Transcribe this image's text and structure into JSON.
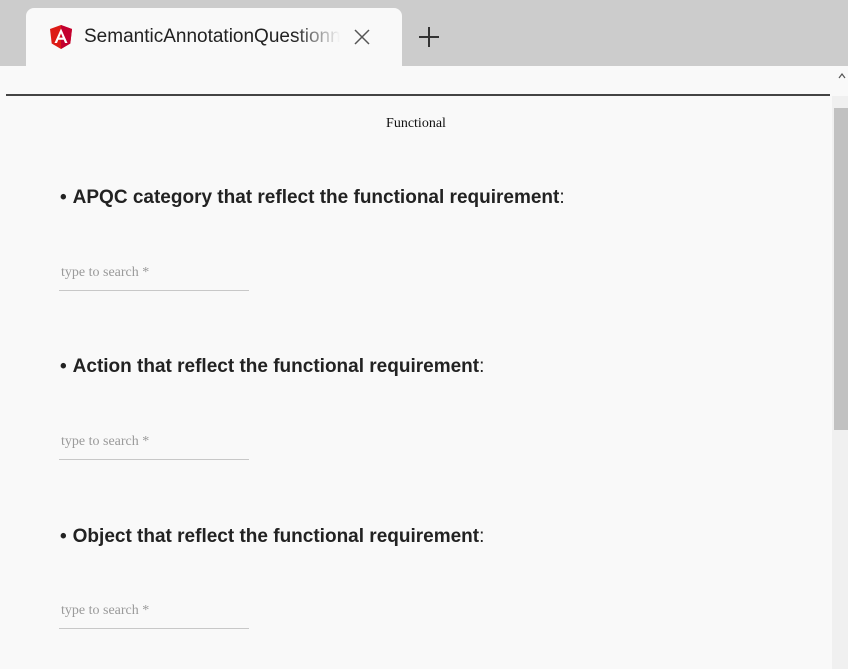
{
  "browser": {
    "tab": {
      "title": "SemanticAnnotationQuestionnaire",
      "icon": "angular-logo-icon"
    },
    "colors": {
      "angular_red": "#dd1b16",
      "tabbar_bg": "#cccccc"
    }
  },
  "page": {
    "section_title": "Functional",
    "questions": [
      {
        "bullet": "•",
        "label": "APQC category that reflect the functional requirement",
        "colon": ":",
        "input_placeholder": "type to search *"
      },
      {
        "bullet": "•",
        "label": "Action that reflect the functional requirement",
        "colon": ":",
        "input_placeholder": "type to search *"
      },
      {
        "bullet": "•",
        "label": "Object that reflect the functional requirement",
        "colon": ":",
        "input_placeholder": "type to search *"
      }
    ]
  }
}
